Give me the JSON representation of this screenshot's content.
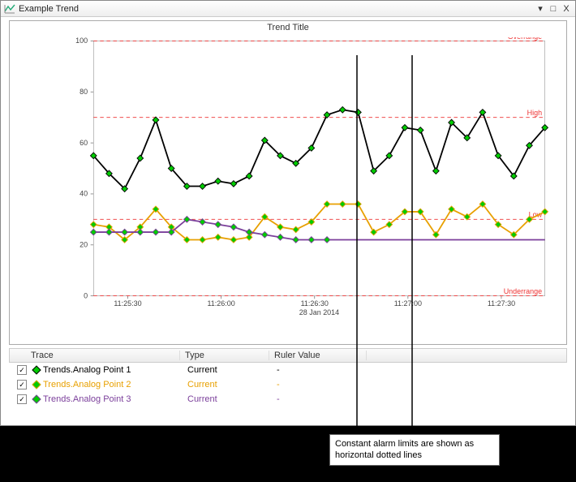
{
  "window": {
    "title": "Example Trend",
    "dropdown_icon": "▾",
    "minimize_icon": "□",
    "close_icon": "X"
  },
  "chart": {
    "title": "Trend Title",
    "date_label": "28 Jan 2014"
  },
  "alarm_labels": {
    "overrange": "Overrange",
    "high": "High",
    "low": "Low",
    "underrange": "Underrange"
  },
  "legend": {
    "headers": {
      "trace": "Trace",
      "type": "Type",
      "ruler": "Ruler Value"
    },
    "rows": [
      {
        "checked": "✓",
        "color_border": "#000",
        "color_fill": "#0c0",
        "name": "Trends.Analog Point 1",
        "type": "Current",
        "ruler": "-",
        "text_color": "#000"
      },
      {
        "checked": "✓",
        "color_border": "#e8a000",
        "color_fill": "#0c0",
        "name": "Trends.Analog Point 2",
        "type": "Current",
        "ruler": "-",
        "text_color": "#e8a000"
      },
      {
        "checked": "✓",
        "color_border": "#7b3f9b",
        "color_fill": "#0c0",
        "name": "Trends.Analog Point 3",
        "type": "Current",
        "ruler": "-",
        "text_color": "#7b3f9b"
      }
    ]
  },
  "callout": {
    "text": "Constant alarm limits are shown as horizontal dotted lines"
  },
  "chart_data": {
    "type": "line",
    "title": "Trend Title",
    "xlabel": "",
    "ylabel": "",
    "ylim": [
      0,
      100
    ],
    "y_ticks": [
      0,
      20,
      40,
      60,
      80,
      100
    ],
    "x_ticks": [
      "11:25:30",
      "11:26:00",
      "11:26:30",
      "11:27:00",
      "11:27:30"
    ],
    "date": "28 Jan 2014",
    "alarm_limits": {
      "overrange": 100,
      "high": 70,
      "low": 30,
      "underrange": 0
    },
    "series": [
      {
        "name": "Trends.Analog Point 1",
        "color": "#000000",
        "marker_fill": "#00cc00",
        "x": [
          "11:25:19",
          "11:25:24",
          "11:25:29",
          "11:25:34",
          "11:25:39",
          "11:25:44",
          "11:25:49",
          "11:25:54",
          "11:25:59",
          "11:26:04",
          "11:26:09",
          "11:26:14",
          "11:26:19",
          "11:26:24",
          "11:26:29",
          "11:26:34",
          "11:26:39",
          "11:26:44",
          "11:26:49",
          "11:26:54",
          "11:26:59",
          "11:27:04",
          "11:27:09",
          "11:27:14",
          "11:27:19",
          "11:27:24",
          "11:27:29",
          "11:27:34",
          "11:27:39",
          "11:27:44"
        ],
        "y": [
          55,
          48,
          42,
          54,
          69,
          50,
          43,
          43,
          45,
          44,
          47,
          61,
          55,
          52,
          58,
          71,
          73,
          72,
          49,
          55,
          66,
          65,
          49,
          68,
          62,
          72,
          55,
          47,
          59,
          66
        ]
      },
      {
        "name": "Trends.Analog Point 2",
        "color": "#e8a000",
        "marker_fill": "#00cc00",
        "x": [
          "11:25:19",
          "11:25:24",
          "11:25:29",
          "11:25:34",
          "11:25:39",
          "11:25:44",
          "11:25:49",
          "11:25:54",
          "11:25:59",
          "11:26:04",
          "11:26:09",
          "11:26:14",
          "11:26:19",
          "11:26:24",
          "11:26:29",
          "11:26:34",
          "11:26:39",
          "11:26:44",
          "11:26:49",
          "11:26:54",
          "11:26:59",
          "11:27:04",
          "11:27:09",
          "11:27:14",
          "11:27:19",
          "11:27:24",
          "11:27:29",
          "11:27:34",
          "11:27:39",
          "11:27:44"
        ],
        "y": [
          28,
          27,
          22,
          27,
          34,
          27,
          22,
          22,
          23,
          22,
          23,
          31,
          27,
          26,
          29,
          36,
          36,
          36,
          25,
          28,
          33,
          33,
          24,
          34,
          31,
          36,
          28,
          24,
          30,
          33
        ]
      },
      {
        "name": "Trends.Analog Point 3",
        "color": "#7b3f9b",
        "marker_fill": "#00cc00",
        "x": [
          "11:25:19",
          "11:25:24",
          "11:25:29",
          "11:25:34",
          "11:25:39",
          "11:25:44",
          "11:25:49",
          "11:25:54",
          "11:25:59",
          "11:26:04",
          "11:26:09",
          "11:26:14",
          "11:26:19",
          "11:26:24",
          "11:26:29",
          "11:26:34"
        ],
        "y": [
          25,
          25,
          25,
          25,
          25,
          25,
          30,
          29,
          28,
          27,
          25,
          24,
          23,
          22,
          22,
          22
        ]
      }
    ],
    "series3_flat_from": "11:26:34",
    "series3_flat_y": 22
  }
}
